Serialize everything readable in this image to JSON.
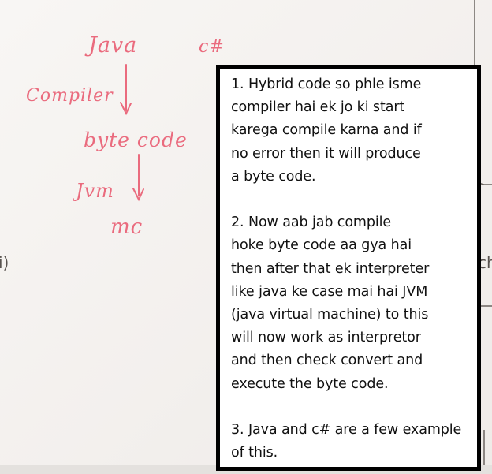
{
  "whiteboard": {
    "labels": {
      "java": "Java",
      "csharp": "c#",
      "compiler": "Compiler",
      "byte_code": "byte code",
      "jvm": "Jvm",
      "mc": "mc"
    },
    "partial_left": "i)",
    "partial_right": "ch",
    "ink_color": "#ea6b7e"
  },
  "note": {
    "point_1": "1. Hybrid code so phle isme\ncompiler hai ek jo ki start\nkarega compile karna and if\nno error then it will produce\na byte code.",
    "point_2": "2. Now aab jab compile\nhoke byte  code aa gya hai\nthen after that ek interpreter\nlike java ke case mai hai JVM\n(java virtual machine) to this\nwill now work as interpretor\nand then check convert and\nexecute the byte code.",
    "point_3": "3. Java and c# are a few example\nof this."
  }
}
